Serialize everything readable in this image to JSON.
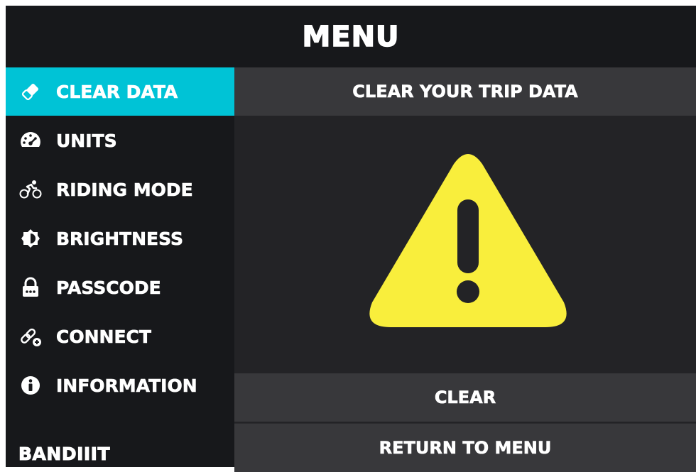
{
  "header": {
    "title": "MENU"
  },
  "sidebar": {
    "items": [
      {
        "label": "CLEAR DATA",
        "icon": "eraser-icon",
        "active": true
      },
      {
        "label": "UNITS",
        "icon": "speedometer-icon",
        "active": false
      },
      {
        "label": "RIDING MODE",
        "icon": "cyclist-icon",
        "active": false
      },
      {
        "label": "BRIGHTNESS",
        "icon": "brightness-icon",
        "active": false
      },
      {
        "label": "PASSCODE",
        "icon": "lock-icon",
        "active": false
      },
      {
        "label": "CONNECT",
        "icon": "link-add-icon",
        "active": false
      },
      {
        "label": "INFORMATION",
        "icon": "info-icon",
        "active": false
      }
    ],
    "logo": "BANDIIIT"
  },
  "main": {
    "heading": "CLEAR YOUR TRIP DATA",
    "warning_icon": "warning-triangle-icon",
    "clear_button": "CLEAR",
    "return_button": "RETURN TO MENU"
  },
  "colors": {
    "accent": "#00c3d6",
    "warning": "#f9ee3c",
    "background": "#17181b",
    "panel": "#38383b"
  }
}
